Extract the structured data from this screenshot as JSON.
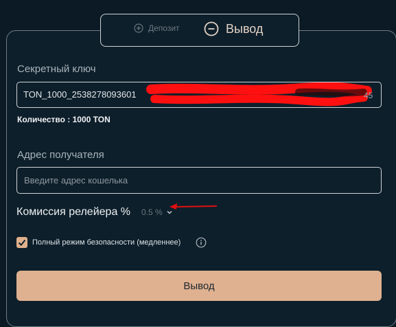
{
  "tabs": {
    "deposit_label": "Депозит",
    "withdraw_label": "Вывод",
    "active": "withdraw"
  },
  "secret": {
    "label": "Секретный ключ",
    "value_visible": "TON_1000_2538278093601",
    "redacted": true
  },
  "amount_text": "Количество : 1000 TON",
  "recipient": {
    "label": "Адрес получателя",
    "placeholder": "Введите адрес кошелька"
  },
  "fee": {
    "label": "Комиссия релейера %",
    "value": "0.5 %"
  },
  "safety": {
    "checked": true,
    "label": "Полный режим безопасности (медленнее)"
  },
  "submit_label": "Вывод",
  "colors": {
    "background": "#0b1a24",
    "accent": "#dfb190",
    "annotation": "#e01010"
  },
  "icons": [
    "plus-circle-icon",
    "minus-circle-icon",
    "chevron-down-icon",
    "check-icon",
    "info-icon",
    "annotation-arrow-icon"
  ]
}
